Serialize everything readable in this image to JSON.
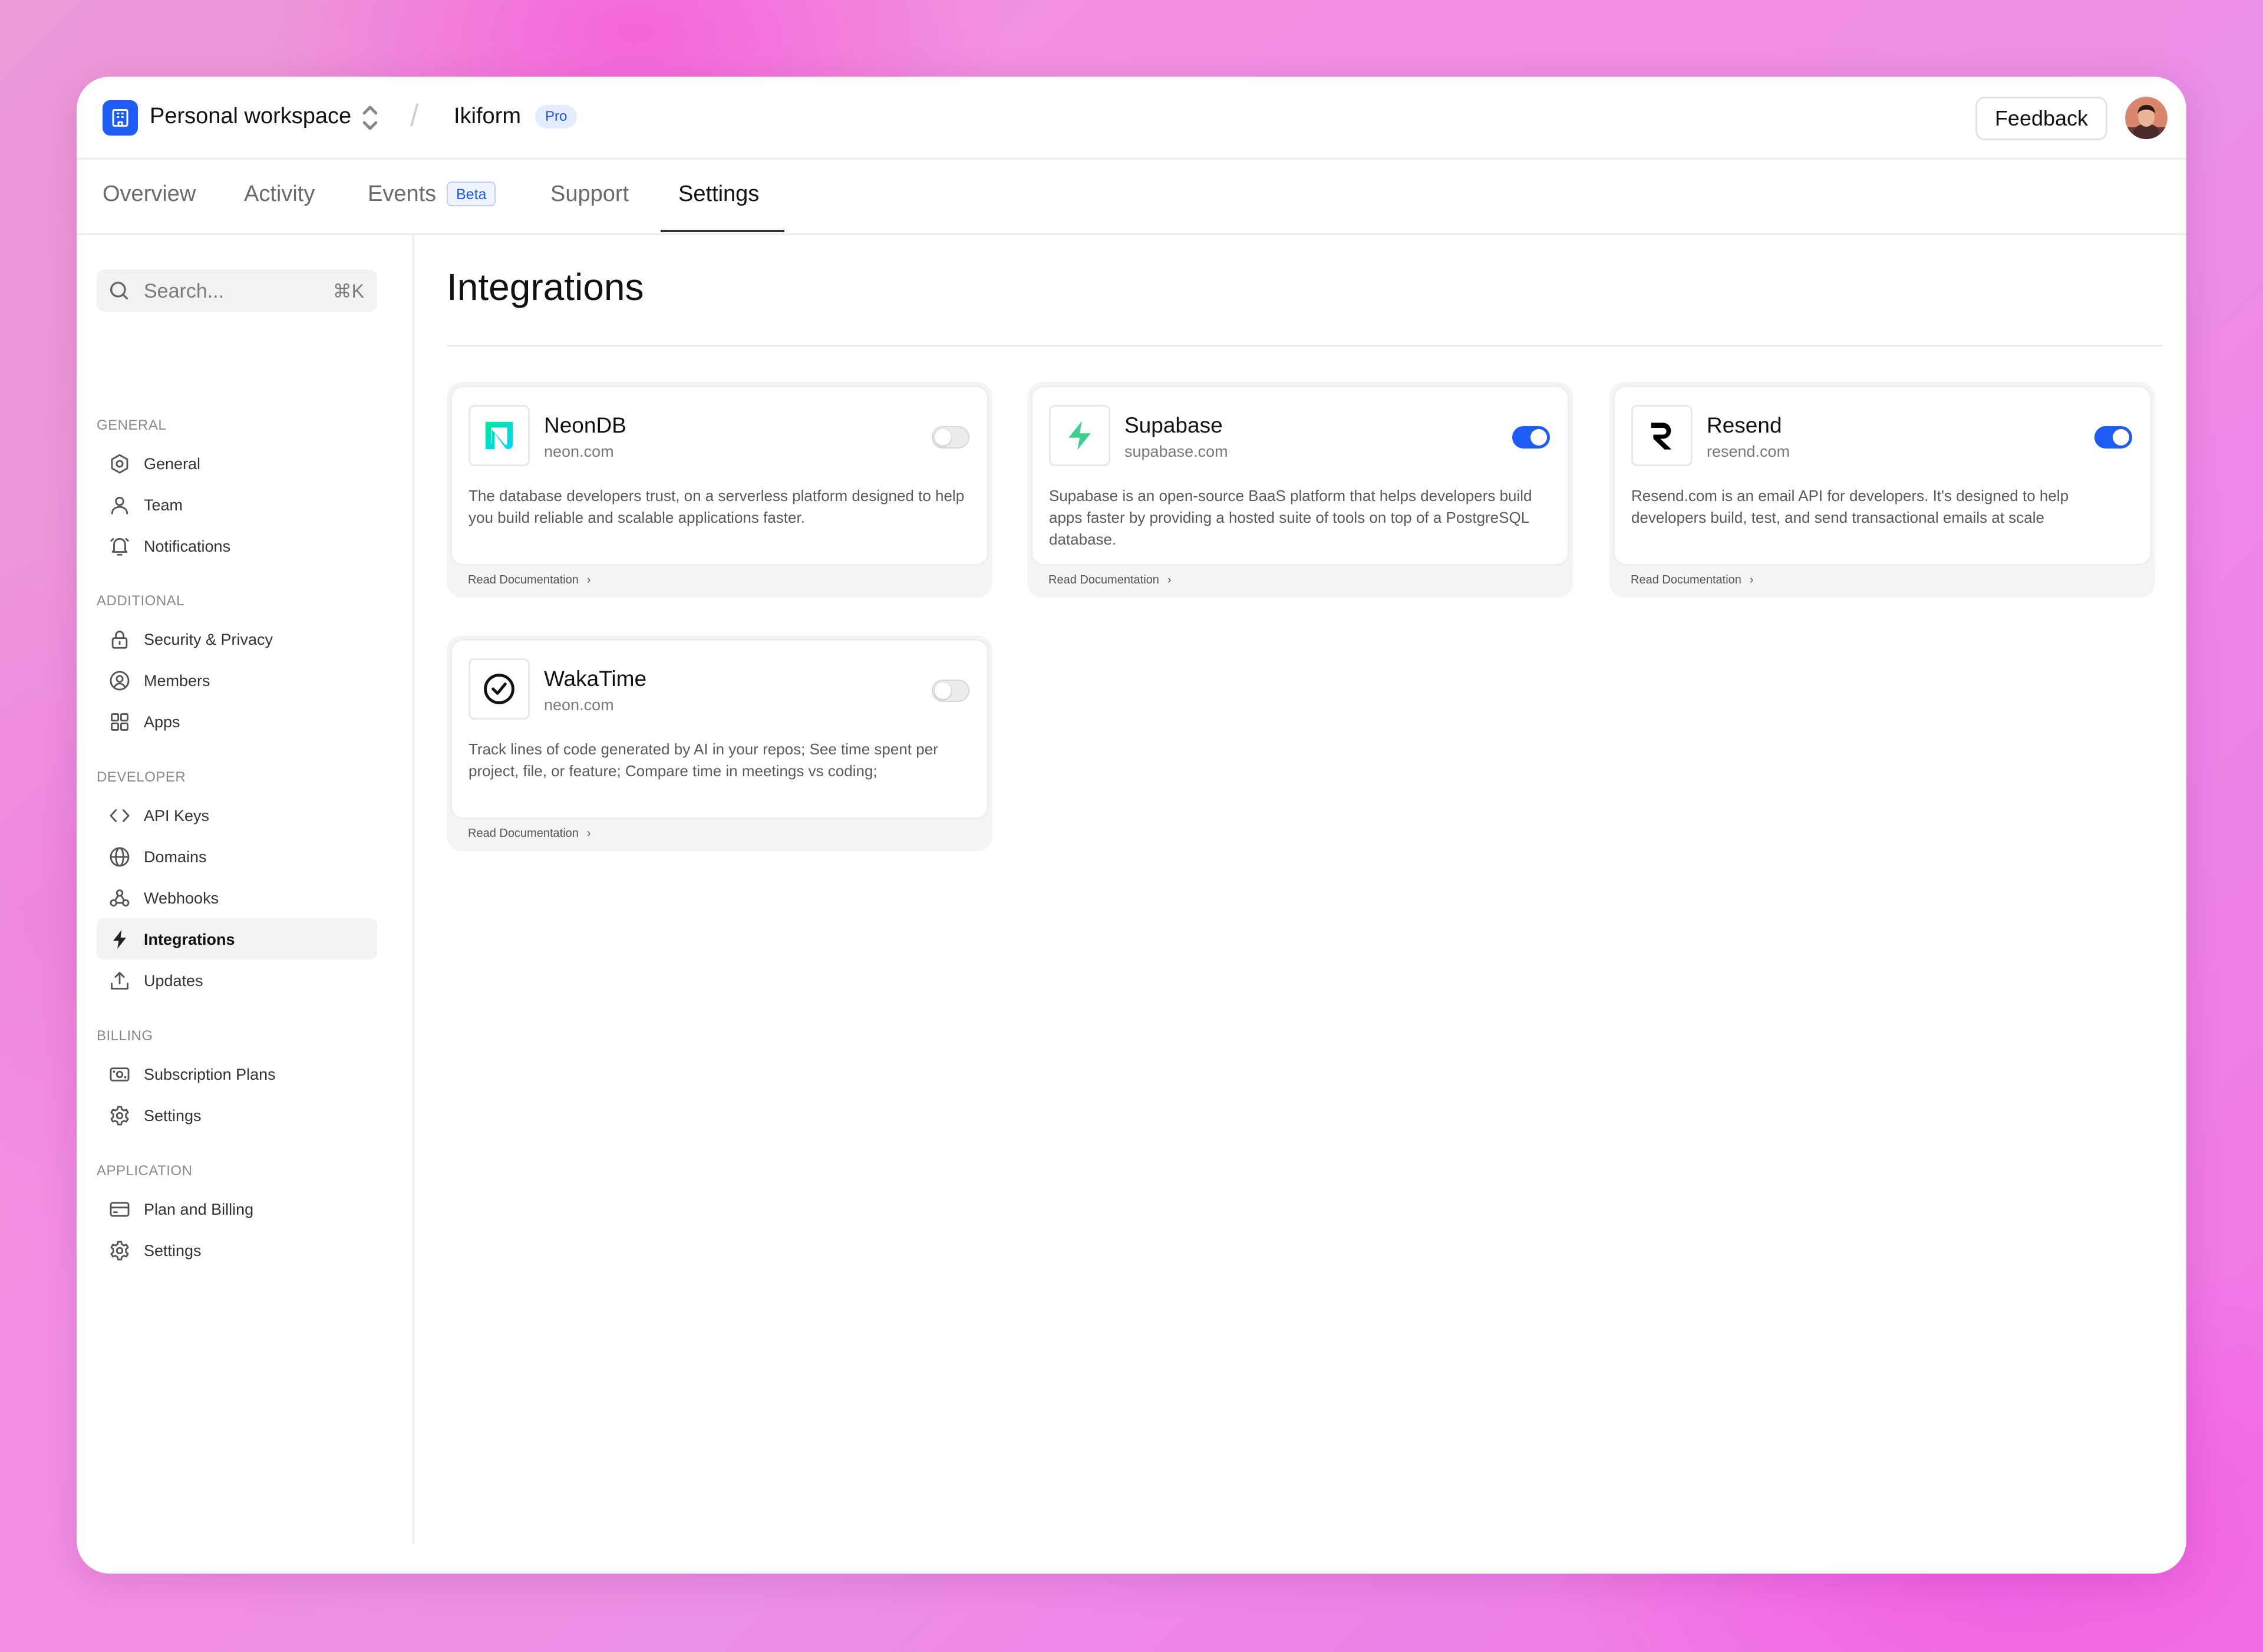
{
  "header": {
    "workspace": "Personal workspace",
    "separator": "/",
    "project": "Ikiform",
    "plan_badge": "Pro",
    "feedback_label": "Feedback"
  },
  "tabs": [
    {
      "label": "Overview",
      "active": false
    },
    {
      "label": "Activity",
      "active": false
    },
    {
      "label": "Events",
      "active": false,
      "badge": "Beta"
    },
    {
      "label": "Support",
      "active": false
    },
    {
      "label": "Settings",
      "active": true
    }
  ],
  "search": {
    "placeholder": "Search...",
    "shortcut": "⌘K"
  },
  "sidebar": {
    "sections": [
      {
        "title": "GENERAL",
        "items": [
          {
            "label": "General",
            "icon": "settings-icon"
          },
          {
            "label": "Team",
            "icon": "user-icon"
          },
          {
            "label": "Notifications",
            "icon": "bell-icon"
          }
        ]
      },
      {
        "title": "ADDITIONAL",
        "items": [
          {
            "label": "Security & Privacy",
            "icon": "lock-icon"
          },
          {
            "label": "Members",
            "icon": "user-circle-icon"
          },
          {
            "label": "Apps",
            "icon": "grid-icon"
          }
        ]
      },
      {
        "title": "DEVELOPER",
        "items": [
          {
            "label": "API Keys",
            "icon": "code-icon"
          },
          {
            "label": "Domains",
            "icon": "globe-icon"
          },
          {
            "label": "Webhooks",
            "icon": "webhook-icon"
          },
          {
            "label": "Integrations",
            "icon": "bolt-icon",
            "active": true
          },
          {
            "label": "Updates",
            "icon": "upload-icon"
          }
        ]
      },
      {
        "title": "BILLING",
        "items": [
          {
            "label": "Subscription Plans",
            "icon": "banknote-icon"
          },
          {
            "label": "Settings",
            "icon": "gear-icon"
          }
        ]
      },
      {
        "title": "APPLICATION",
        "items": [
          {
            "label": "Plan and Billing",
            "icon": "credit-card-icon"
          },
          {
            "label": "Settings",
            "icon": "gear-icon"
          }
        ]
      }
    ]
  },
  "main": {
    "title": "Integrations",
    "cards": [
      {
        "name": "NeonDB",
        "domain": "neon.com",
        "enabled": false,
        "logo": "neondb-logo-icon",
        "description": "The database developers trust, on a serverless platform designed to help you build reliable and scalable applications faster.",
        "doc_label": "Read Documentation"
      },
      {
        "name": "Supabase",
        "domain": "supabase.com",
        "enabled": true,
        "logo": "supabase-logo-icon",
        "description": "Supabase is an open-source BaaS platform that helps developers build apps faster by providing a hosted suite of tools on top of a PostgreSQL database.",
        "doc_label": "Read Documentation"
      },
      {
        "name": "Resend",
        "domain": "resend.com",
        "enabled": true,
        "logo": "resend-logo-icon",
        "description": "Resend.com is an email API for developers. It's designed to help developers build, test, and send transactional emails at scale",
        "doc_label": "Read Documentation"
      },
      {
        "name": "WakaTime",
        "domain": "neon.com",
        "enabled": false,
        "logo": "wakatime-logo-icon",
        "description": "Track lines of code generated by AI in your repos; See time spent per project, file, or feature; Compare time in meetings vs coding;",
        "doc_label": "Read Documentation"
      }
    ]
  },
  "colors": {
    "accent": "#1f5cf5",
    "supabase": "#3ecf8e",
    "neon_start": "#00e599",
    "neon_end": "#00d4ff"
  }
}
